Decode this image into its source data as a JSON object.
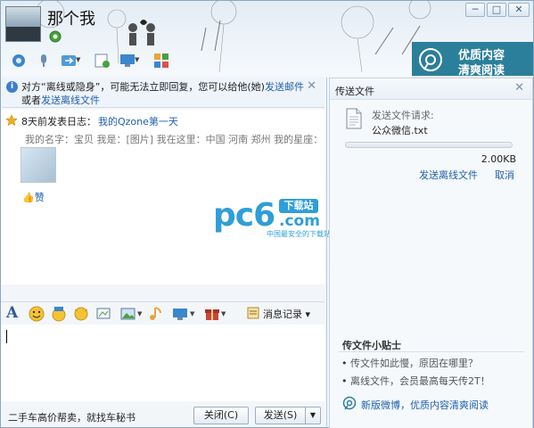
{
  "window": {
    "title": "那个我",
    "min_glyph": "─",
    "max_glyph": "□",
    "close_glyph": "✕"
  },
  "header": {
    "contact_name": "那个我",
    "ad": {
      "line1": "优质内容",
      "line2": "清爽阅读"
    }
  },
  "notice": {
    "text_prefix": "对方“离线或隐身”，可能无法立即回复，您可以给他(她)",
    "link_send_email": "发送邮件",
    "text_or": "或者",
    "link_send_offline": "发送离线文件",
    "close_glyph": "✕"
  },
  "feed": {
    "title": "8天前发表日志：",
    "link": "我的Qzone第一天",
    "excerpt": "我的名字：宝贝 我是：[图片] 我在这里：中国 河南 郑州 我的星座：",
    "like_label": "赞"
  },
  "watermark": {
    "brand": "pc6",
    "tag": "下载站",
    "domain": ".com",
    "slogan": "中国最安全的下载站"
  },
  "input_toolbar": {
    "history_label": "消息记录"
  },
  "bottom": {
    "ad_text": "二手车高价帮卖，就找车秘书",
    "close_label": "关闭(C)",
    "send_label": "发送(S)",
    "send_more_glyph": "▼"
  },
  "file_panel": {
    "title": "传送文件",
    "close_glyph": "✕",
    "request_label": "发送文件请求:",
    "file_name": "公众微信.txt",
    "file_size": "2.00KB",
    "progress": 0,
    "send_offline_label": "发送离线文件",
    "cancel_label": "取消",
    "tips_title": "传文件小贴士",
    "tips": [
      {
        "bullet": "•",
        "text": "传文件如此慢，原因在哪里？"
      },
      {
        "bullet": "•",
        "text": "离线文件，会员最高每天传2T！"
      }
    ],
    "weibo_label": "新版微博，优质内容清爽阅读"
  },
  "colors": {
    "link": "#1f5fad",
    "accent": "#2f9ed8",
    "ad_bg": "#2b7f9a"
  }
}
